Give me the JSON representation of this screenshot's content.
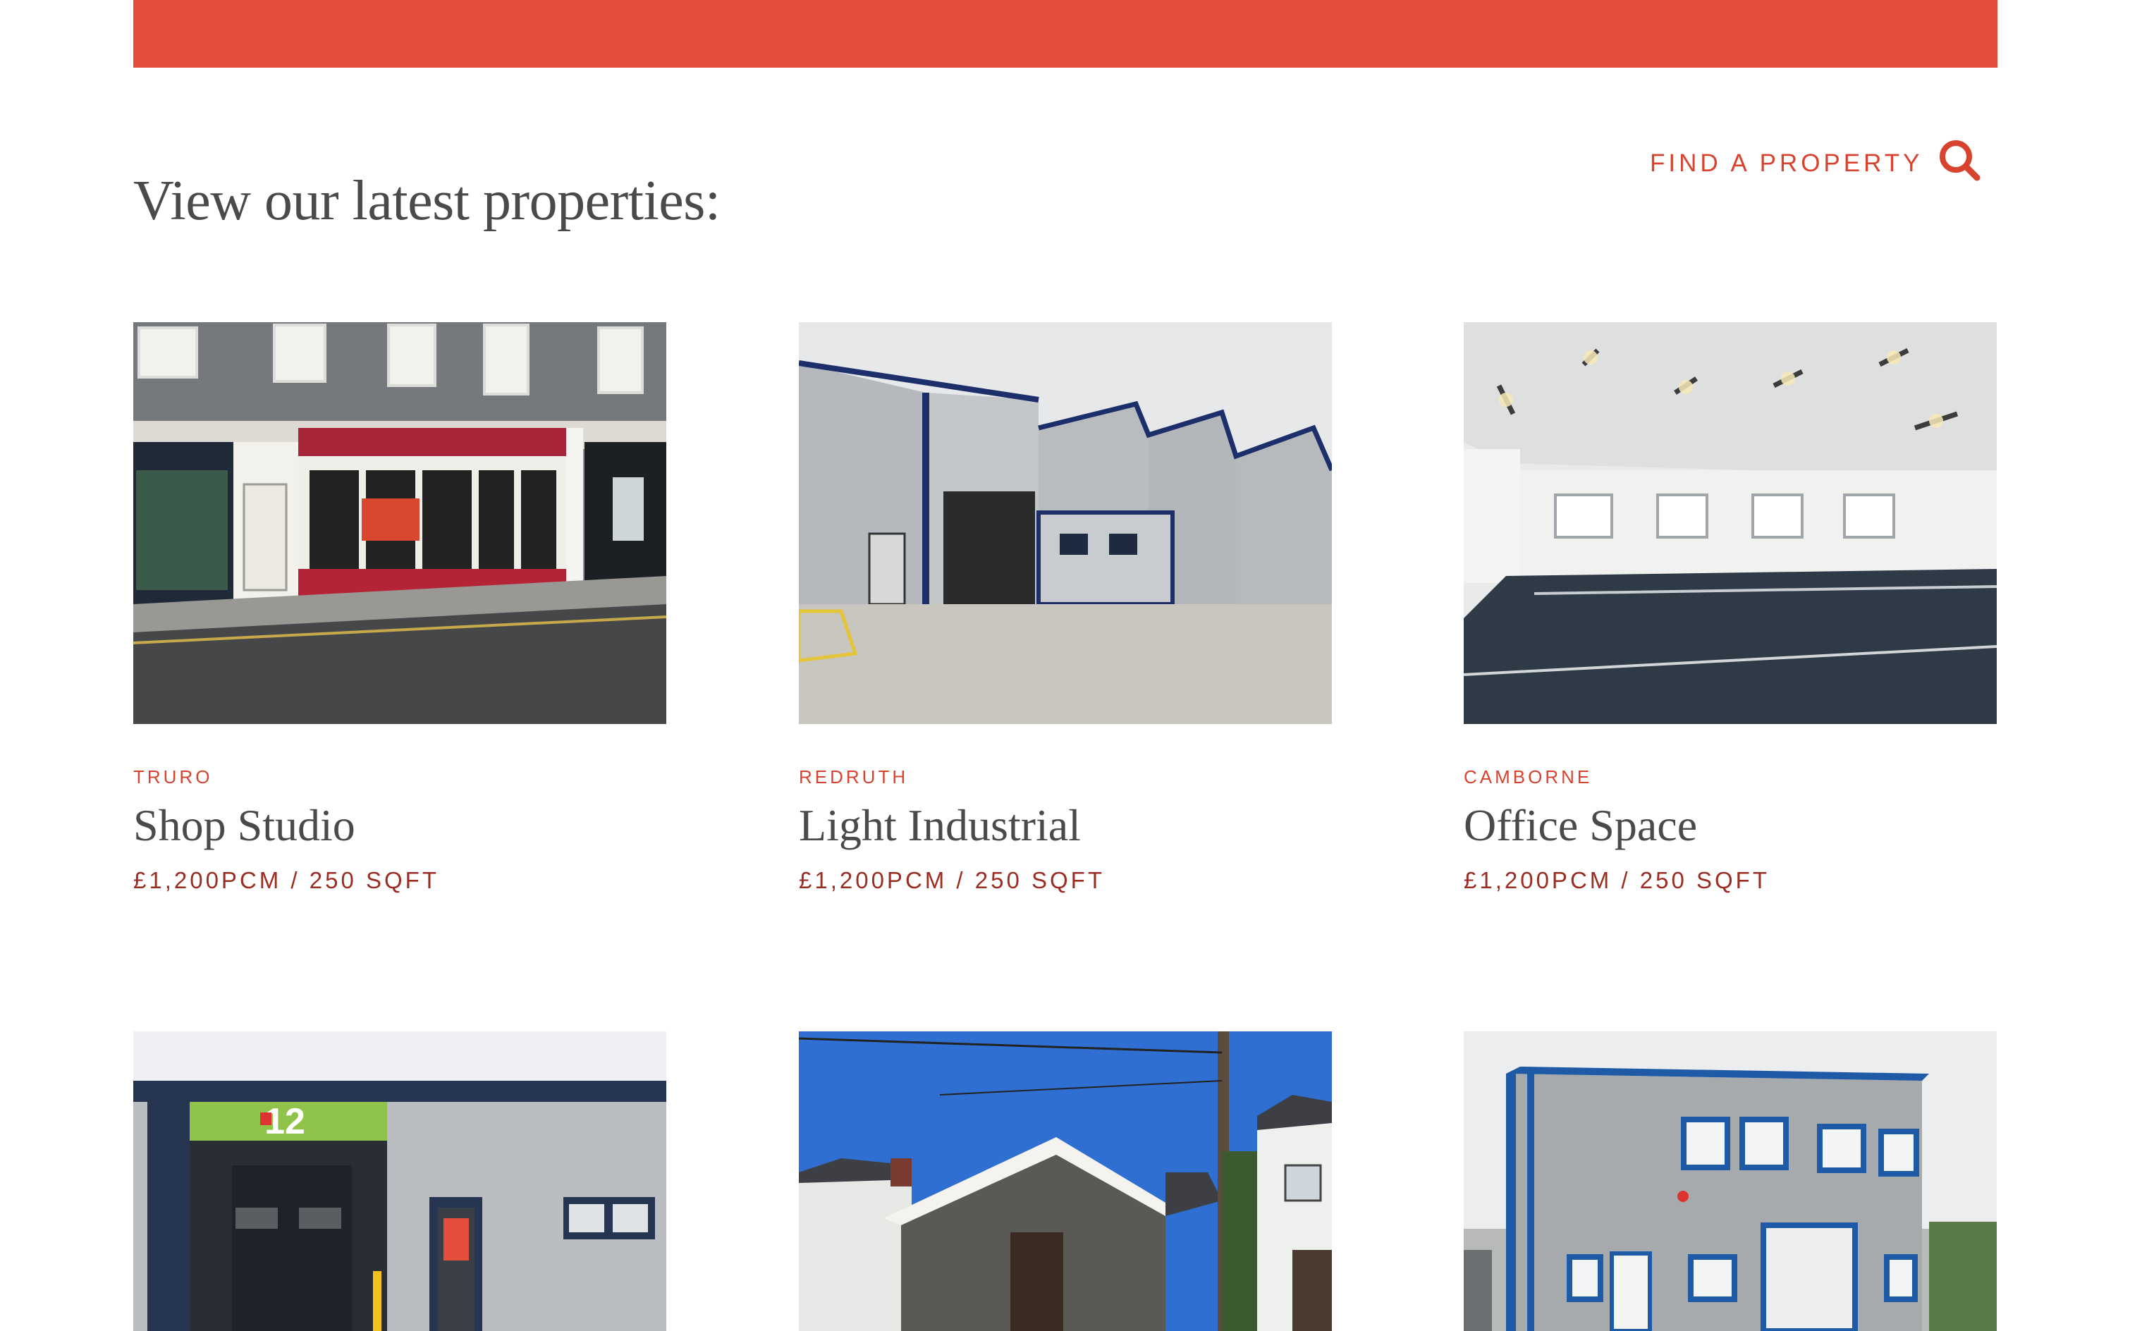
{
  "section_heading": "View our latest properties:",
  "find_property": {
    "label": "FIND A PROPERTY",
    "icon": "search-icon"
  },
  "colors": {
    "accent": "#e44e3b",
    "label": "#d8432f",
    "price": "#9a2e22",
    "heading": "#4a4a4a"
  },
  "properties": [
    {
      "location": "TRURO",
      "title": "Shop Studio",
      "price": "£1,200PCM / 250 SQFT"
    },
    {
      "location": "REDRUTH",
      "title": "Light Industrial",
      "price": "£1,200PCM / 250 SQFT"
    },
    {
      "location": "CAMBORNE",
      "title": "Office Space",
      "price": "£1,200PCM / 250 SQFT"
    },
    {
      "photo_text": "12"
    },
    {},
    {}
  ]
}
